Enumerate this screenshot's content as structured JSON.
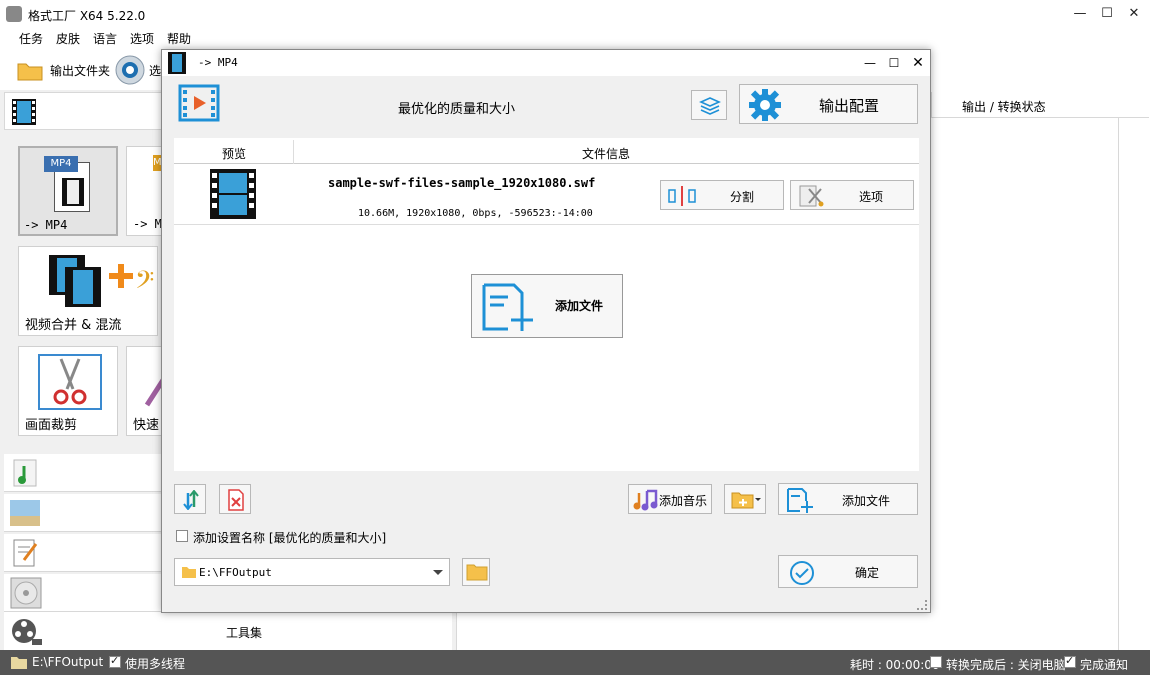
{
  "app": {
    "title": "格式工厂 X64 5.22.0",
    "menu": [
      "任务",
      "皮肤",
      "语言",
      "选项",
      "帮助"
    ],
    "toolbar": {
      "output_folder": "输出文件夹",
      "options_partial": "选"
    },
    "right_header": "输出 / 转换状态",
    "tiles": [
      {
        "label": "-> MP4",
        "badge": "MP4"
      },
      {
        "label": "-> M",
        "badge": "M"
      },
      {
        "label": "视频合并 & 混流"
      },
      {
        "label": "画面裁剪"
      },
      {
        "label": "快速"
      }
    ],
    "bottom_panel": {
      "toolbox": "工具集"
    }
  },
  "status": {
    "path": "E:\\FFOutput",
    "multithread": "使用多线程",
    "elapsed": "耗时 : 00:00:00",
    "after_convert": "转换完成后 : 关闭电脑",
    "notify": "完成通知"
  },
  "dialog": {
    "title": "-> MP4",
    "quality": "最优化的质量和大小",
    "output_config": "输出配置",
    "columns": {
      "preview": "预览",
      "file_info": "文件信息"
    },
    "file": {
      "name": "sample-swf-files-sample_1920x1080.swf",
      "meta": "10.66M, 1920x1080, 0bps, -596523:-14:00"
    },
    "split": "分割",
    "options": "选项",
    "add_file_center": "添加文件",
    "add_music": "添加音乐",
    "add_file_bottom": "添加文件",
    "setting_name_checkbox": "添加设置名称 [最优化的质量和大小]",
    "output_path": "E:\\FFOutput",
    "ok": "确定"
  },
  "colors": {
    "accent": "#1e90d6",
    "status_bar": "#555555",
    "red": "#e04040"
  }
}
